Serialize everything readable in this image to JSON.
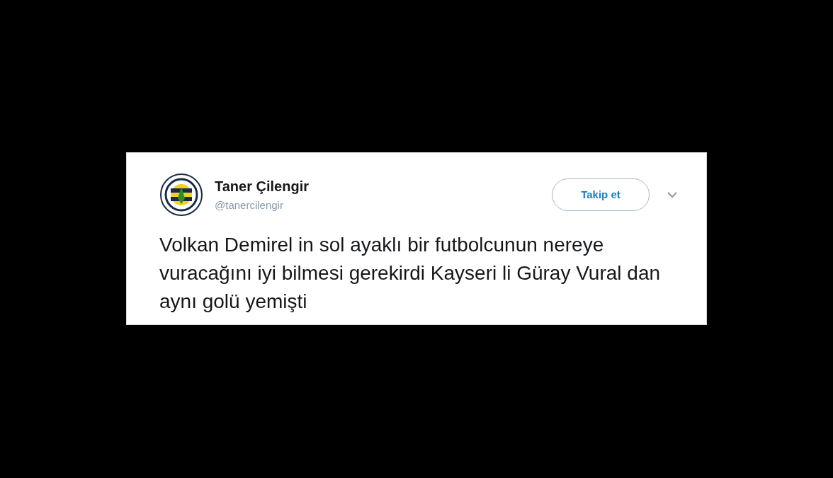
{
  "tweet": {
    "name": "Taner Çilengir",
    "handle": "@tanercilengir",
    "follow_button": "Takip et",
    "text": "Volkan Demirel in sol ayaklı bir futbolcunun nereye vuracağını iyi bilmesi gerekirdi Kayseri li Güray Vural dan aynı golü yemişti"
  }
}
